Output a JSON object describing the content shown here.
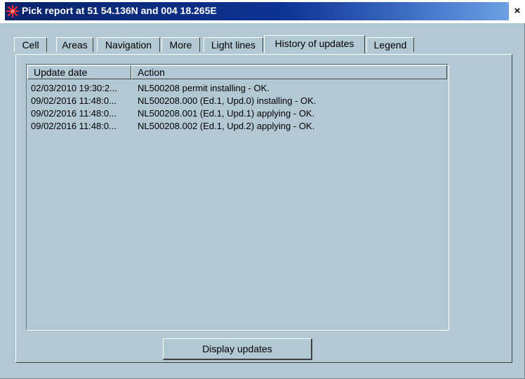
{
  "window": {
    "title": "Pick report at 51 54.136N and 004 18.265E",
    "close_glyph": "×",
    "title_icon": "star-burst-icon"
  },
  "tabs": [
    {
      "label": "Cell"
    },
    {
      "label": "Areas"
    },
    {
      "label": "Navigation"
    },
    {
      "label": "More"
    },
    {
      "label": "Light lines"
    },
    {
      "label": "History of updates",
      "active": true
    },
    {
      "label": "Legend"
    }
  ],
  "list": {
    "columns": [
      "Update date",
      "Action"
    ],
    "rows": [
      {
        "date": "02/03/2010 19:30:2...",
        "action": "NL500208 permit installing - OK."
      },
      {
        "date": "09/02/2016 11:48:0...",
        "action": "NL500208.000 (Ed.1, Upd.0) installing - OK."
      },
      {
        "date": "09/02/2016 11:48:0...",
        "action": "NL500208.001 (Ed.1, Upd.1) applying - OK."
      },
      {
        "date": "09/02/2016 11:48:0...",
        "action": "NL500208.002 (Ed.1, Upd.2) applying - OK."
      }
    ]
  },
  "buttons": {
    "display_updates": "Display updates"
  },
  "colors": {
    "dialog_bg": "#b2c8d3",
    "titlebar_start": "#0a246a",
    "titlebar_end": "#6da0e4",
    "title_text": "#ffffff",
    "icon_color": "#ff2a2a"
  }
}
